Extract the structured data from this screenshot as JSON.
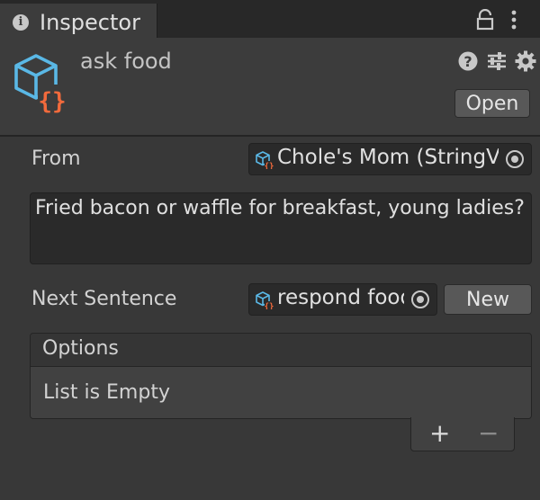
{
  "tab": {
    "title": "Inspector",
    "info_icon": "info-icon",
    "lock_icon": "lock-icon",
    "menu_icon": "kebab-menu-icon"
  },
  "header": {
    "object_name": "ask food",
    "object_icon": "scriptable-object-icon",
    "icons": [
      "help-icon",
      "presets-icon",
      "gear-icon"
    ],
    "open_label": "Open"
  },
  "fields": {
    "from": {
      "label": "From",
      "value": "Chole's Mom (StringVa",
      "picker_icon": "object-picker-icon"
    },
    "text": {
      "value": "Fried bacon or waffle for breakfast, young ladies?"
    },
    "next_sentence": {
      "label": "Next Sentence",
      "value": "respond food",
      "picker_icon": "object-picker-icon",
      "new_label": "New"
    }
  },
  "options": {
    "header": "Options",
    "empty_text": "List is Empty",
    "add_label": "+",
    "remove_label": "−"
  },
  "colors": {
    "background": "#383838",
    "tab_bar": "#282828",
    "field_bg": "#2a2a2a",
    "button_bg": "#585858",
    "icon_blue": "#5ab8e6",
    "icon_orange": "#f26a3c"
  }
}
